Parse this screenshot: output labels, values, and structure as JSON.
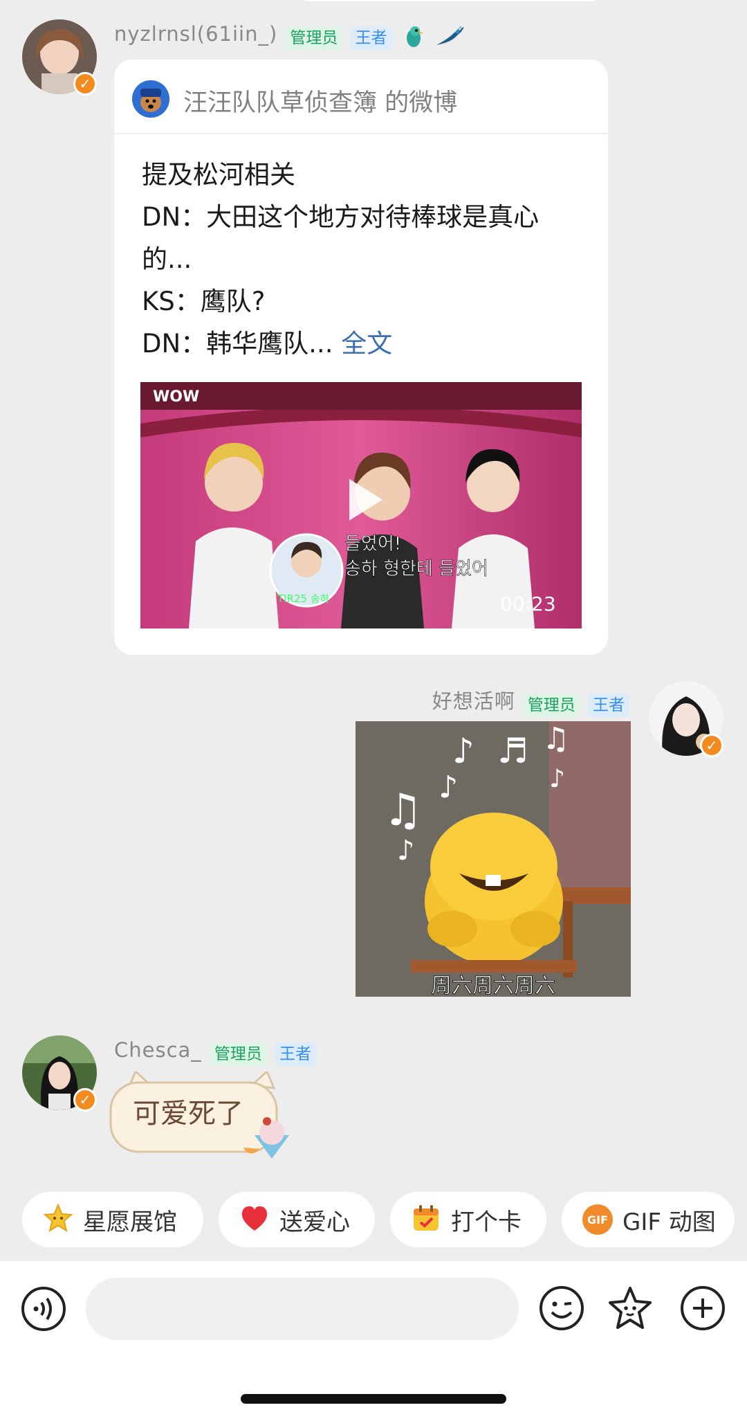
{
  "messages": [
    {
      "username": "nyzlrnsl(61iin_)",
      "tags": [
        "管理员",
        "王者"
      ],
      "shared_post": {
        "source": "汪汪队队草侦查簿 的微博",
        "lines": [
          "提及松河相关",
          "DN：大田这个地方对待棒球是真心",
          "的...",
          "KS：鹰队?",
          "DN：韩华鹰队..."
        ],
        "more": "全文",
        "video": {
          "logo": "WOW",
          "caption_line1": "들었어!",
          "caption_line2": "송하 형한테 들었어",
          "name_tag": "TIR25 송하",
          "duration": "00:23"
        }
      }
    },
    {
      "username": "好想活啊",
      "tags": [
        "管理员",
        "王者"
      ],
      "sticker_caption": "周六周六周六"
    },
    {
      "username": "Chesca_",
      "tags": [
        "管理员",
        "王者"
      ],
      "text": "可爱死了"
    }
  ],
  "quick_actions": [
    "星愿展馆",
    "送爱心",
    "打个卡",
    "GIF 动图"
  ],
  "gif_icon_label": "GIF",
  "colors": {
    "admin_tag": "#1aa260",
    "king_tag": "#3a8ee6",
    "link": "#3b6fb2",
    "verified": "#f28a1e"
  }
}
